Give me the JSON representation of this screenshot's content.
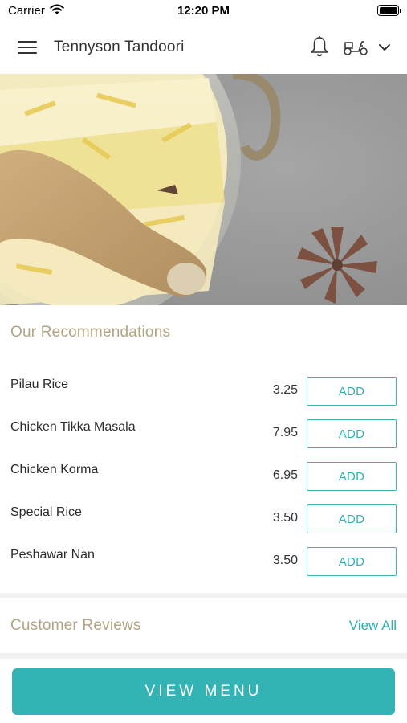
{
  "status_bar": {
    "carrier": "Carrier",
    "time": "12:20 PM"
  },
  "header": {
    "title": "Tennyson Tandoori"
  },
  "recommendations": {
    "title": "Our Recommendations",
    "items": [
      {
        "name": "Pilau Rice",
        "price": "3.25",
        "add_label": "ADD"
      },
      {
        "name": "Chicken Tikka Masala",
        "price": "7.95",
        "add_label": "ADD"
      },
      {
        "name": "Chicken Korma",
        "price": "6.95",
        "add_label": "ADD"
      },
      {
        "name": "Special Rice",
        "price": "3.50",
        "add_label": "ADD"
      },
      {
        "name": "Peshawar Nan",
        "price": "3.50",
        "add_label": "ADD"
      }
    ]
  },
  "reviews": {
    "title": "Customer Reviews",
    "view_all_label": "View All"
  },
  "footer": {
    "view_menu_label": "VIEW MENU"
  },
  "colors": {
    "accent": "#33b3b3",
    "section_title": "#b3a481"
  }
}
